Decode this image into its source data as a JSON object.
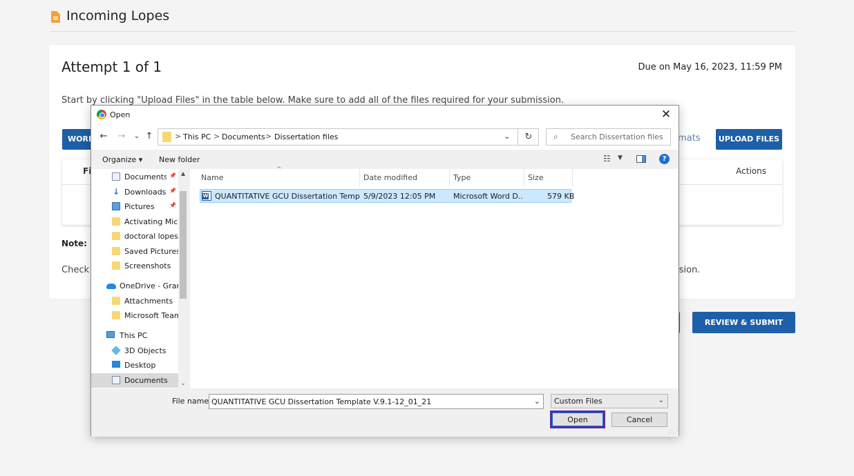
{
  "page": {
    "header_title": "Incoming Lopes",
    "attempt_title": "Attempt 1 of 1",
    "due_text": "Due on May 16, 2023, 11:59 PM",
    "instructions": "Start by clicking \"Upload Files\" in the table below. Make sure to add all of the files required for your submission.",
    "work_button": "WORK",
    "formats_link": "rmats",
    "upload_button": "UPLOAD FILES",
    "table_col_file": "Fi",
    "table_col_actions": "Actions",
    "note_label": "Note:",
    "check_text": "Check y",
    "check_tail": "ssion.",
    "review_button": "REVIEW & SUBMIT",
    "colors": {
      "primary": "#1d5fa8",
      "focus_outline": "#5b2d9c"
    }
  },
  "dialog": {
    "title": "Open",
    "close": "✕",
    "nav": {
      "back": "←",
      "forward": "→",
      "recent": "⌄",
      "up": "↑"
    },
    "breadcrumb": [
      "This PC",
      "Documents",
      "Dissertation files"
    ],
    "breadcrumb_sep": ">",
    "refresh": "↻",
    "search_placeholder": "Search Dissertation files",
    "toolbar": {
      "organize": "Organize ▾",
      "new_folder": "New folder",
      "help": "?"
    },
    "tree": [
      {
        "label": "Documents",
        "icon": "document-icon",
        "pinned": true
      },
      {
        "label": "Downloads",
        "icon": "download-icon",
        "pinned": true
      },
      {
        "label": "Pictures",
        "icon": "pictures-icon",
        "pinned": true
      },
      {
        "label": "Activating Micro",
        "icon": "folder-icon",
        "pinned": false
      },
      {
        "label": "doctoral lopeswr",
        "icon": "folder-icon",
        "pinned": false
      },
      {
        "label": "Saved Pictures",
        "icon": "folder-icon",
        "pinned": false
      },
      {
        "label": "Screenshots",
        "icon": "folder-icon",
        "pinned": false
      },
      {
        "label": "OneDrive - Grand",
        "icon": "onedrive-icon",
        "pinned": false
      },
      {
        "label": "Attachments",
        "icon": "folder-icon",
        "pinned": false
      },
      {
        "label": "Microsoft Teams",
        "icon": "folder-icon",
        "pinned": false
      },
      {
        "label": "This PC",
        "icon": "computer-icon",
        "pinned": false
      },
      {
        "label": "3D Objects",
        "icon": "cube-icon",
        "pinned": false
      },
      {
        "label": "Desktop",
        "icon": "desktop-icon",
        "pinned": false
      },
      {
        "label": "Documents",
        "icon": "document-icon",
        "pinned": false
      }
    ],
    "columns": {
      "name": "Name",
      "date": "Date modified",
      "type": "Type",
      "size": "Size"
    },
    "files": [
      {
        "name": "QUANTITATIVE GCU Dissertation Templat...",
        "date": "5/9/2023 12:05 PM",
        "type": "Microsoft Word D...",
        "size": "579 KB"
      }
    ],
    "file_name_label": "File name:",
    "file_name_value": "QUANTITATIVE GCU Dissertation Template V.9.1-12_01_21",
    "file_type": "Custom Files",
    "open_button": "Open",
    "cancel_button": "Cancel"
  }
}
